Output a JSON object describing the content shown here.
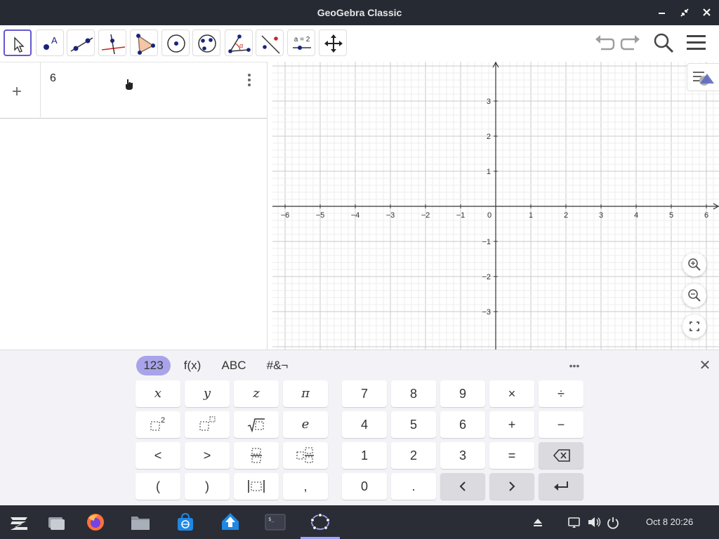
{
  "window": {
    "title": "GeoGebra Classic",
    "controls": {
      "minimize_icon": "minimize-icon",
      "restore_icon": "restore-icon",
      "close_icon": "close-icon"
    }
  },
  "toolbar": {
    "tools": [
      {
        "name": "move-tool",
        "icon": "arrow-cursor-icon",
        "active": true
      },
      {
        "name": "point-tool",
        "icon": "point-icon",
        "label": "A"
      },
      {
        "name": "line-tool",
        "icon": "line-through-points-icon"
      },
      {
        "name": "perpendicular-line-tool",
        "icon": "perpendicular-icon"
      },
      {
        "name": "polygon-tool",
        "icon": "polygon-icon"
      },
      {
        "name": "circle-center-point-tool",
        "icon": "circle-icon"
      },
      {
        "name": "ellipse-tool",
        "icon": "conic-icon"
      },
      {
        "name": "angle-tool",
        "icon": "angle-icon"
      },
      {
        "name": "reflect-tool",
        "icon": "reflect-icon"
      },
      {
        "name": "slider-tool",
        "icon": "slider-icon",
        "label": "a = 2"
      },
      {
        "name": "move-graphics-tool",
        "icon": "move-arrows-icon"
      }
    ],
    "right": {
      "undo_icon": "undo-icon",
      "redo_icon": "redo-icon",
      "search_icon": "search-icon",
      "menu_icon": "hamburger-menu-icon"
    }
  },
  "algebra": {
    "add_symbol": "+",
    "input_value": "6",
    "more_icon": "more-vertical-icon"
  },
  "graphics": {
    "x_ticks": [
      "−6",
      "−5",
      "−4",
      "−3",
      "−2",
      "−1",
      "0",
      "1",
      "2",
      "3",
      "4",
      "5",
      "6"
    ],
    "y_ticks": [
      "3",
      "2",
      "1",
      "−1",
      "−2",
      "−3"
    ],
    "style_bar_icon": "graphics-style-icon",
    "zoom_in_icon": "zoom-in-icon",
    "zoom_out_icon": "zoom-out-icon",
    "fullscreen_icon": "fullscreen-icon"
  },
  "keyboard": {
    "tabs": [
      "123",
      "f(x)",
      "ABC",
      "#&¬"
    ],
    "active_tab": "123",
    "more_label": "•••",
    "close_label": "✕",
    "left_keys": [
      [
        "x",
        "y",
        "z",
        "π"
      ],
      [
        "□²",
        "□ⁿ",
        "√□",
        "e"
      ],
      [
        "<",
        ">",
        "fraction",
        "mixed"
      ],
      [
        "(",
        ")",
        "|□|",
        ","
      ]
    ],
    "num_keys": [
      [
        "7",
        "8",
        "9",
        "×",
        "÷"
      ],
      [
        "4",
        "5",
        "6",
        "+",
        "−"
      ],
      [
        "1",
        "2",
        "3",
        "=",
        "⌫"
      ],
      [
        "0",
        ".",
        "‹",
        "›",
        "↵"
      ]
    ]
  },
  "taskbar": {
    "apps": [
      "zorin-menu-icon",
      "files-switcher-icon",
      "firefox-icon",
      "file-manager-icon",
      "software-store-icon",
      "update-icon",
      "terminal-icon",
      "geogebra-icon"
    ],
    "tray": [
      "eject-icon",
      "display-icon",
      "volume-icon",
      "power-icon"
    ],
    "clock": "Oct 8  20:26"
  },
  "colors": {
    "accent": "#6557d2",
    "titlebar": "#262a33",
    "taskbar": "#2a2d36",
    "keyboard_bg": "#f3f3f7"
  }
}
